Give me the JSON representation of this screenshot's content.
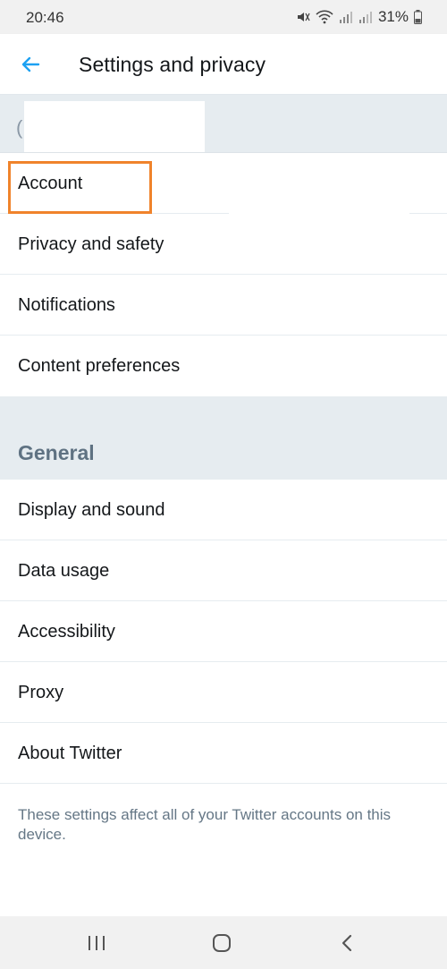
{
  "status_bar": {
    "time": "20:46",
    "battery": "31%"
  },
  "app_bar": {
    "title": "Settings and privacy",
    "back_icon": "arrow-left-icon",
    "accent_color": "#1da1f2"
  },
  "account_section": {
    "prefix_char": "("
  },
  "account_items": [
    {
      "label": "Account",
      "highlighted": true
    },
    {
      "label": "Privacy and safety"
    },
    {
      "label": "Notifications"
    },
    {
      "label": "Content preferences"
    }
  ],
  "general_section": {
    "title": "General",
    "items": [
      {
        "label": "Display and sound"
      },
      {
        "label": "Data usage"
      },
      {
        "label": "Accessibility"
      },
      {
        "label": "Proxy"
      },
      {
        "label": "About Twitter"
      }
    ]
  },
  "footer": {
    "note": "These settings affect all of your Twitter accounts on this device."
  },
  "nav_bar": {
    "recents_icon": "recents-icon",
    "home_icon": "home-icon",
    "back_icon": "back-chevron-icon"
  },
  "colors": {
    "highlight": "#f0832b",
    "section_bg": "#e6ecf0",
    "section_title": "#5f7282",
    "footer_text": "#657786"
  }
}
